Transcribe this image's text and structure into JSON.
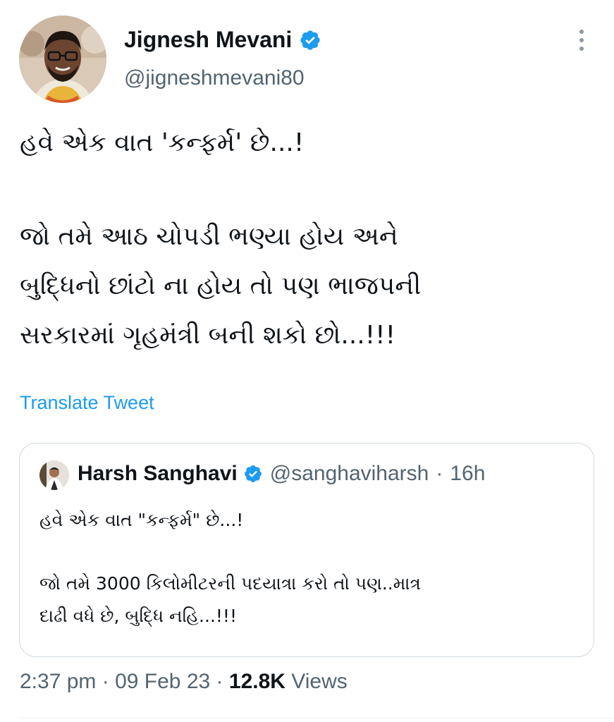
{
  "author": {
    "name": "Jignesh Mevani",
    "handle": "@jigneshmevani80"
  },
  "tweet": {
    "lines": [
      "હવે એક વાત 'કન્ફર્મ' છે...!",
      "જો તમે આઠ ચોપડી ભણ્યા હોય અને",
      "બુદ્ધિનો છાંટો ના હોય તો પણ ભાજપની",
      "સરકારમાં ગૃહમંત્રી બની શકો છો...!!!"
    ],
    "translate_label": "Translate Tweet"
  },
  "quoted": {
    "name": "Harsh Sanghavi",
    "handle": "@sanghaviharsh",
    "separator": "·",
    "time": "16h",
    "lines": [
      "હવે એક વાત \"કન્ફર્મ\" છે...!",
      "જો તમે 3000 કિલોમીટરની પદયાત્રા કરો તો પણ..માત્ર",
      "દાઢી વધે છે, બુદ્ધિ નહિ...!!!"
    ]
  },
  "meta": {
    "time": "2:37 pm",
    "sep": "·",
    "date": "09 Feb 23",
    "views_count": "12.8K",
    "views_label": "Views"
  },
  "colors": {
    "verified": "#1d9bf0",
    "link": "#1d9bf0",
    "secondary_text": "#536471"
  },
  "icons": {
    "verified": "verified-badge-icon",
    "more": "more-vertical-icon"
  }
}
